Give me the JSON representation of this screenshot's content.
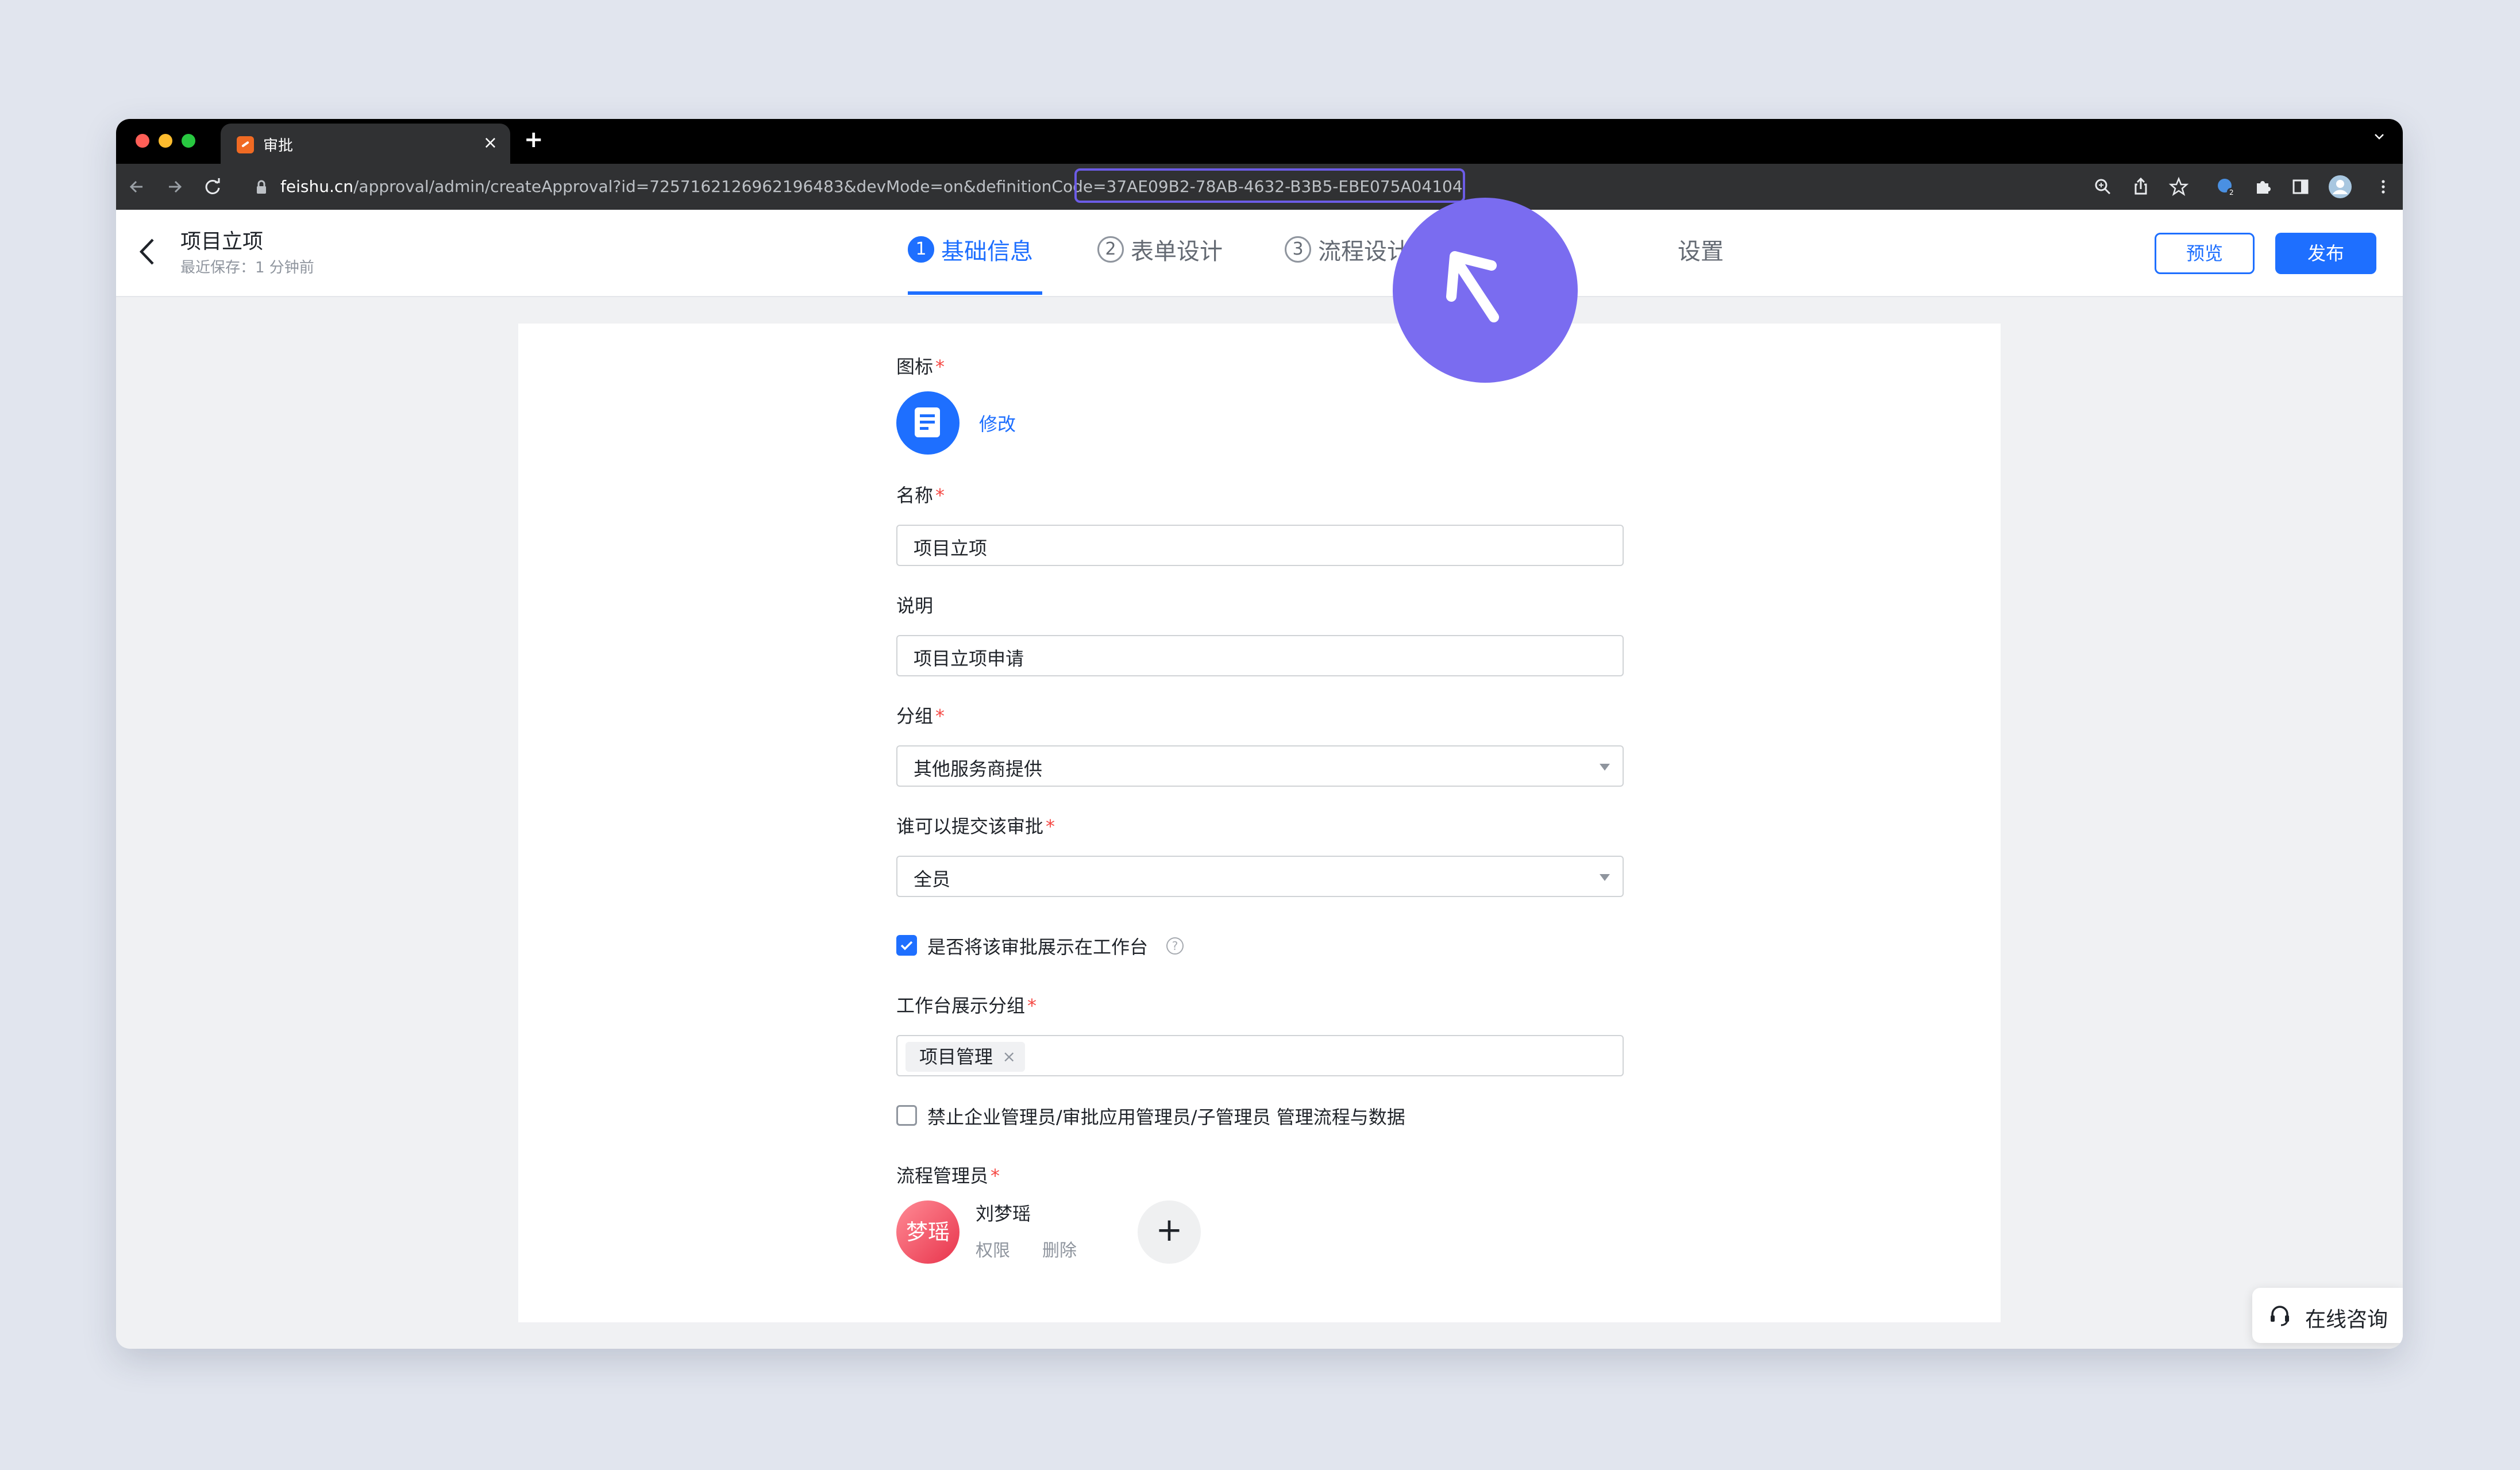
{
  "browser": {
    "tab_title": "审批",
    "tab_close": "×",
    "new_tab": "+",
    "url_host": "feishu.cn",
    "url_path": "/approval/admin/createApproval?id=7257162126962196483&devMode=on&definitionCode=",
    "url_code": "37AE09B2-78AB-4632-B3B5-EBE075A04104"
  },
  "header": {
    "title": "项目立项",
    "subtitle": "最近保存：1 分钟前",
    "steps": [
      {
        "num": "1",
        "label": "基础信息",
        "active": true
      },
      {
        "num": "2",
        "label": "表单设计",
        "active": false
      },
      {
        "num": "3",
        "label": "流程设计",
        "active": false
      },
      {
        "num": "",
        "label": "设置",
        "active": false
      }
    ],
    "preview_label": "预览",
    "publish_label": "发布"
  },
  "form": {
    "icon_label": "图标",
    "icon_modify": "修改",
    "name_label": "名称",
    "name_value": "项目立项",
    "desc_label": "说明",
    "desc_value": "项目立项申请",
    "group_label": "分组",
    "group_value": "其他服务商提供",
    "submitter_label": "谁可以提交该审批",
    "submitter_value": "全员",
    "show_workbench_label": "是否将该审批展示在工作台",
    "show_workbench_checked": true,
    "help_glyph": "?",
    "workbench_group_label": "工作台展示分组",
    "workbench_group_tag": "项目管理",
    "tag_remove": "×",
    "forbid_label": "禁止企业管理员/审批应用管理员/子管理员 管理流程与数据",
    "forbid_checked": false,
    "admin_label": "流程管理员",
    "required_mark": "*",
    "admins": [
      {
        "avatar_text": "梦瑶",
        "name": "刘梦瑶",
        "action_permission": "权限",
        "action_delete": "删除"
      }
    ],
    "add_admin": "+"
  },
  "support": {
    "consult_label": "在线咨询"
  },
  "colors": {
    "accent": "#1e6fff",
    "required": "#f54a45",
    "cursor_badge": "#7a6cf0",
    "url_highlight": "#6c5ce7"
  },
  "icons": [
    "back-arrow-icon",
    "forward-arrow-icon",
    "reload-icon",
    "lock-icon",
    "zoom-icon",
    "share-icon",
    "star-icon",
    "extension-icon",
    "puzzle-icon",
    "sidebar-icon",
    "profile-icon",
    "kebab-menu-icon",
    "document-icon",
    "cursor-arrow-icon",
    "headset-icon",
    "chevron-down-icon"
  ]
}
